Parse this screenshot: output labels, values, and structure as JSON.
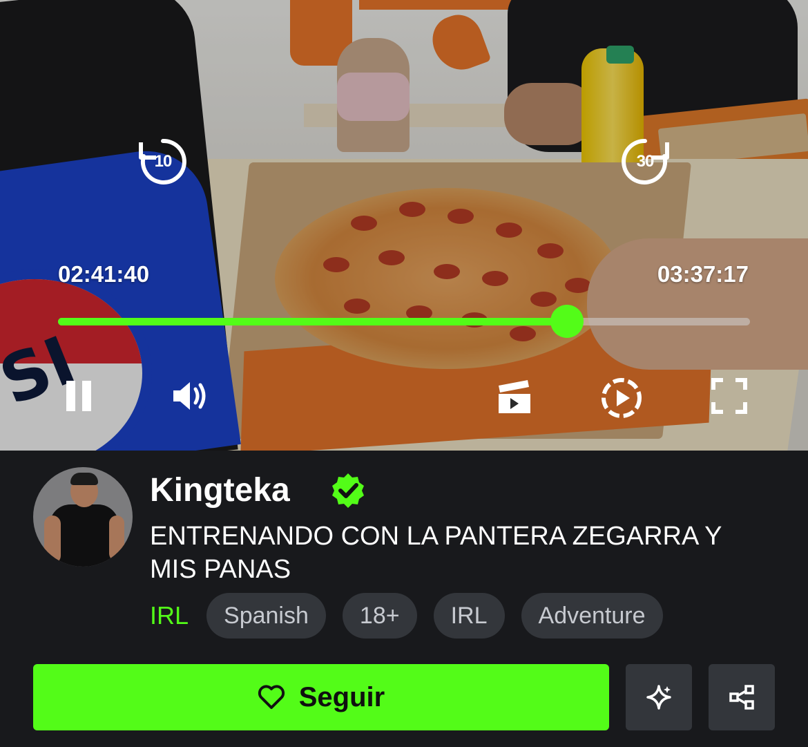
{
  "player": {
    "current_time": "02:41:40",
    "total_time": "03:37:17",
    "progress": 0.736,
    "skip_back_label": "10",
    "skip_forward_label": "30",
    "accent_color": "#53fc18",
    "icons": {
      "skip_back": "rewind-10-icon",
      "skip_forward": "forward-30-icon",
      "pause": "pause-icon",
      "volume": "volume-icon",
      "clip": "clip-icon",
      "speed": "playback-speed-icon",
      "fullscreen": "fullscreen-icon"
    }
  },
  "channel": {
    "name": "Kingteka",
    "verified_icon": "verified-badge-icon",
    "title": "ENTRENANDO CON LA PANTERA ZEGARRA Y MIS PANAS",
    "category": "IRL",
    "tags": [
      "Spanish",
      "18+",
      "IRL",
      "Adventure"
    ]
  },
  "actions": {
    "follow_label": "Seguir",
    "follow_icon": "heart-icon",
    "sparkle_icon": "sparkle-icon",
    "share_icon": "share-icon"
  }
}
